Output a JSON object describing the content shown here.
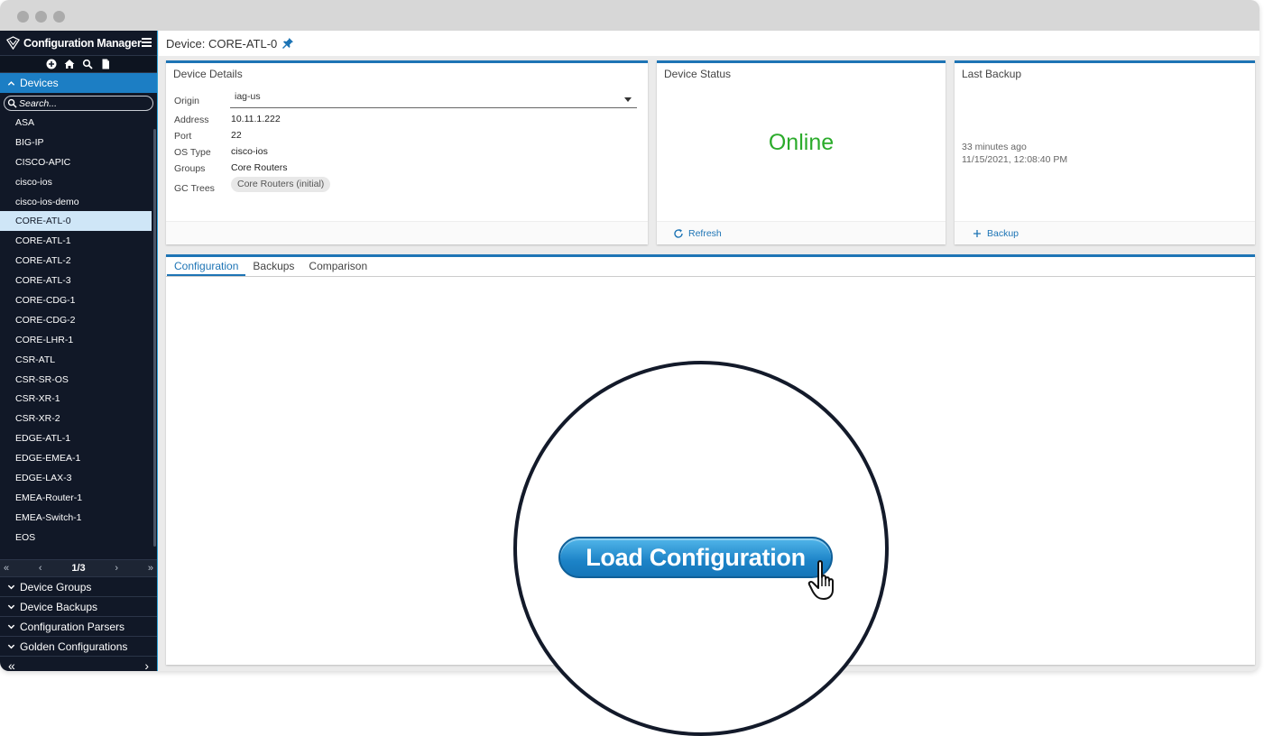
{
  "app": {
    "title": "Configuration Manager"
  },
  "sidebar": {
    "devices_section": "Devices",
    "search_placeholder": "Search...",
    "devices": [
      "ASA",
      "BIG-IP",
      "CISCO-APIC",
      "cisco-ios",
      "cisco-ios-demo",
      "CORE-ATL-0",
      "CORE-ATL-1",
      "CORE-ATL-2",
      "CORE-ATL-3",
      "CORE-CDG-1",
      "CORE-CDG-2",
      "CORE-LHR-1",
      "CSR-ATL",
      "CSR-SR-OS",
      "CSR-XR-1",
      "CSR-XR-2",
      "EDGE-ATL-1",
      "EDGE-EMEA-1",
      "EDGE-LAX-3",
      "EMEA-Router-1",
      "EMEA-Switch-1",
      "EOS"
    ],
    "selected_device": "CORE-ATL-0",
    "pager": {
      "page": "1/3",
      "first": "«",
      "prev": "‹",
      "next": "›",
      "last": "»"
    },
    "sections": [
      "Device Groups",
      "Device Backups",
      "Configuration Parsers",
      "Golden Configurations"
    ],
    "footer": {
      "collapse": "«",
      "expand": "›"
    },
    "accent": "#1c7ec4",
    "background": "#111827"
  },
  "header": {
    "title": "Device: CORE-ATL-0"
  },
  "device_details": {
    "title": "Device Details",
    "origin_label": "Origin",
    "origin_value": "iag-us",
    "address_label": "Address",
    "address_value": "10.11.1.222",
    "port_label": "Port",
    "port_value": "22",
    "os_label": "OS Type",
    "os_value": "cisco-ios",
    "groups_label": "Groups",
    "groups_value": "Core Routers",
    "gc_label": "GC Trees",
    "gc_value": "Core Routers (initial)"
  },
  "device_status": {
    "title": "Device Status",
    "status": "Online",
    "status_color": "#2bab2b",
    "refresh_label": "Refresh"
  },
  "last_backup": {
    "title": "Last Backup",
    "relative": "33 minutes ago",
    "timestamp": "11/15/2021, 12:08:40 PM",
    "backup_label": "Backup"
  },
  "tabs": [
    "Configuration",
    "Backups",
    "Comparison"
  ],
  "active_tab": "Configuration",
  "load_button": "Load Configuration",
  "accent_color": "#1d74b5"
}
